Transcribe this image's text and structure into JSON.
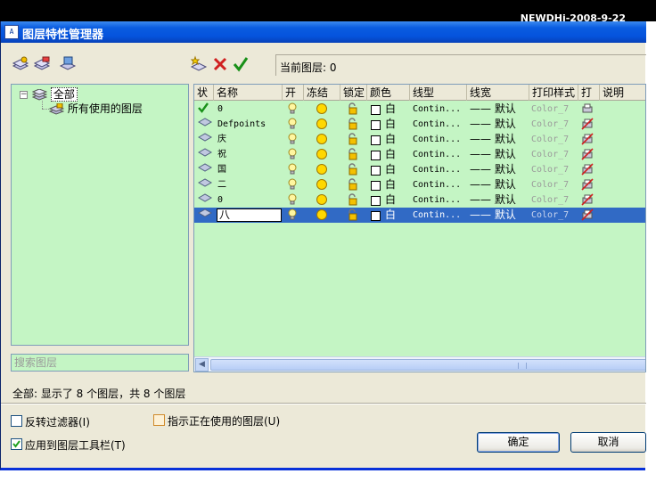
{
  "watermark": "NEWDHj-2008-9-22",
  "window": {
    "title": "图层特性管理器",
    "icon_text": "AutoCAD"
  },
  "current_layer": {
    "label": "当前图层:",
    "value": "0"
  },
  "icons": {
    "filter_toolbar": [
      "new-property-filter-icon",
      "new-group-filter-icon",
      "layer-states-manager-icon"
    ],
    "layer_toolbar": [
      "new-layer-icon",
      "delete-layer-icon",
      "set-current-icon"
    ]
  },
  "tree": {
    "root": "全部",
    "child": "所有使用的图层"
  },
  "search": {
    "placeholder": "搜索图层"
  },
  "grid": {
    "columns": [
      "状",
      "名称",
      "开",
      "冻结",
      "锁定",
      "颜色",
      "线型",
      "线宽",
      "打印样式",
      "打",
      "说明"
    ],
    "rows": [
      {
        "status": "current-check",
        "name": "0",
        "color": "白",
        "linetype": "Contin...",
        "lineweight": "—— 默认",
        "plotstyle": "Color_7",
        "plot": "printer"
      },
      {
        "status": "layer",
        "name": "Defpoints",
        "color": "白",
        "linetype": "Contin...",
        "lineweight": "—— 默认",
        "plotstyle": "Color_7",
        "plot": "no-plot"
      },
      {
        "status": "layer",
        "name": "庆",
        "color": "白",
        "linetype": "Contin...",
        "lineweight": "—— 默认",
        "plotstyle": "Color_7",
        "plot": "no-plot"
      },
      {
        "status": "layer",
        "name": "祝",
        "color": "白",
        "linetype": "Contin...",
        "lineweight": "—— 默认",
        "plotstyle": "Color_7",
        "plot": "no-plot"
      },
      {
        "status": "layer",
        "name": "国",
        "color": "白",
        "linetype": "Contin...",
        "lineweight": "—— 默认",
        "plotstyle": "Color_7",
        "plot": "no-plot"
      },
      {
        "status": "layer",
        "name": "二",
        "color": "白",
        "linetype": "Contin...",
        "lineweight": "—— 默认",
        "plotstyle": "Color_7",
        "plot": "no-plot"
      },
      {
        "status": "layer",
        "name": "0",
        "color": "白",
        "linetype": "Contin...",
        "lineweight": "—— 默认",
        "plotstyle": "Color_7",
        "plot": "no-plot"
      },
      {
        "status": "layer",
        "name": "八",
        "color": "白",
        "linetype": "Contin...",
        "lineweight": "—— 默认",
        "plotstyle": "Color_7",
        "plot": "no-plot",
        "editing": true
      }
    ]
  },
  "status_text": "全部: 显示了 8 个图层，共 8 个图层",
  "options": {
    "invert_filter": {
      "label": "反转过滤器(I)",
      "checked": false
    },
    "indicate_used": {
      "label": "指示正在使用的图层(U)",
      "checked": false
    },
    "apply_toolbar": {
      "label": "应用到图层工具栏(T)",
      "checked": true
    }
  },
  "buttons": {
    "ok": "确定",
    "cancel": "取消"
  },
  "colors": {
    "grid_bg": "#c4f5c4",
    "selection": "#316ac5",
    "titlebar": "#0553dd"
  }
}
